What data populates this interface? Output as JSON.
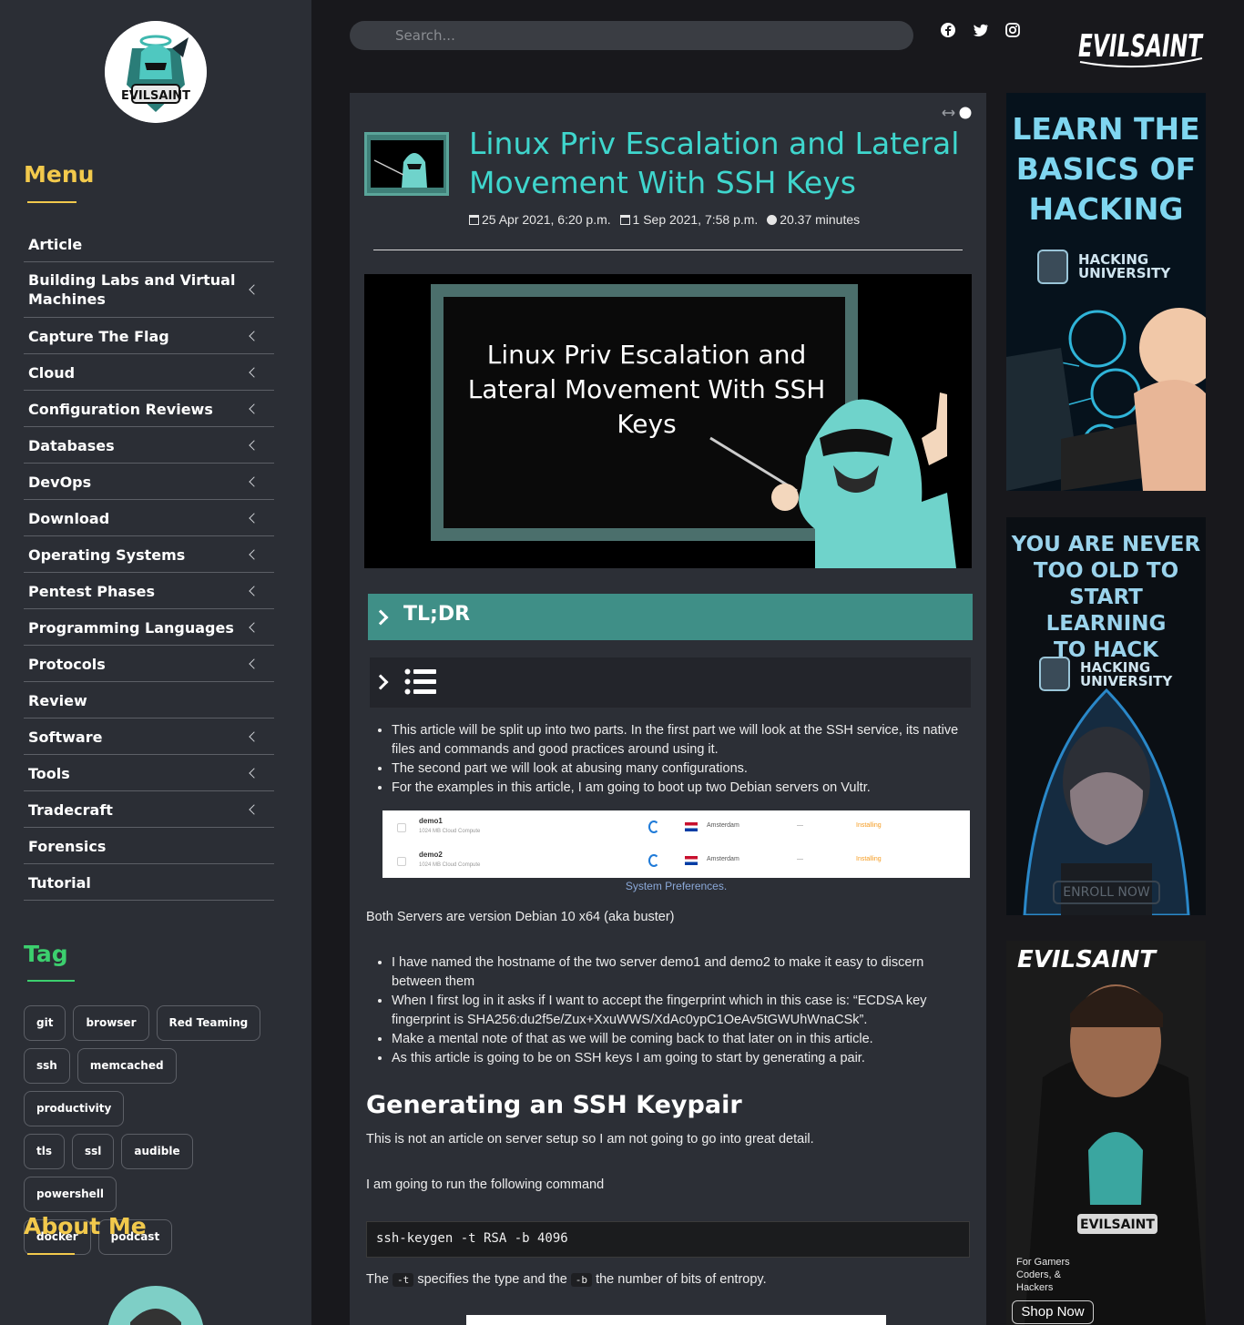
{
  "sidebar": {
    "menu_heading": "Menu",
    "menu": [
      {
        "label": "Article",
        "has_children": false
      },
      {
        "label": "Building Labs and Virtual Machines",
        "has_children": true
      },
      {
        "label": "Capture The Flag",
        "has_children": true
      },
      {
        "label": "Cloud",
        "has_children": true
      },
      {
        "label": "Configuration Reviews",
        "has_children": true
      },
      {
        "label": "Databases",
        "has_children": true
      },
      {
        "label": "DevOps",
        "has_children": true
      },
      {
        "label": "Download",
        "has_children": true
      },
      {
        "label": "Operating Systems",
        "has_children": true
      },
      {
        "label": "Pentest Phases",
        "has_children": true
      },
      {
        "label": "Programming Languages",
        "has_children": true
      },
      {
        "label": "Protocols",
        "has_children": true
      },
      {
        "label": "Review",
        "has_children": false
      },
      {
        "label": "Software",
        "has_children": true
      },
      {
        "label": "Tools",
        "has_children": true
      },
      {
        "label": "Tradecraft",
        "has_children": true
      },
      {
        "label": "Forensics",
        "has_children": false
      },
      {
        "label": "Tutorial",
        "has_children": false
      }
    ],
    "tag_heading": "Tag",
    "tags": [
      "git",
      "browser",
      "Red Teaming",
      "ssh",
      "memcached",
      "productivity",
      "tls",
      "ssl",
      "audible",
      "powershell",
      "docker",
      "podcast"
    ],
    "about_heading": "About Me",
    "logo_text": "EVILSAINT"
  },
  "header": {
    "search_placeholder": "Search...",
    "social": [
      "facebook-icon",
      "twitter-icon",
      "instagram-icon"
    ],
    "brand": "EVILSAINT"
  },
  "article": {
    "title": "Linux Priv Escalation and Lateral Movement With SSH Keys",
    "created": "25 Apr 2021, 6:20 p.m.",
    "updated": "1 Sep 2021, 7:58 p.m.",
    "read_time": "20.37 minutes",
    "hero_text": "Linux Priv Escalation and Lateral Movement With SSH Keys",
    "tldr_label": "TL;DR",
    "intro_bullets": [
      "This article will be split up into two parts. In the first part we will look at the SSH service, its native files and commands and good practices around using it.",
      "The second part we will look at abusing many configurations.",
      "For the examples in this article, I am going to boot up two Debian servers on Vultr."
    ],
    "servers": [
      {
        "name": "demo1",
        "spec": "1024 MB Cloud Compute",
        "location": "Amsterdam",
        "ip": "—",
        "status": "Installing"
      },
      {
        "name": "demo2",
        "spec": "1024 MB Cloud Compute",
        "location": "Amsterdam",
        "ip": "—",
        "status": "Installing"
      }
    ],
    "figure_caption": "System Preferences.",
    "versions_text": "Both Servers are version Debian 10 x64 (aka buster)",
    "host_bullets": [
      "I have named the hostname of the two server demo1 and demo2 to make it easy to discern between them",
      "When I first log in it asks if I want to accept the fingerprint which in this case is: “ECDSA key fingerprint is SHA256:du2f5e/Zux+XxuWWS/XdAc0ypC1OeAv5tGWUhWnaCSk”.",
      "Make a mental note of that as we will be coming back to that later on in this article.",
      "As this article is going to be on SSH keys I am going to start by generating a pair."
    ],
    "h2": "Generating an SSH Keypair",
    "p1": "This is not an article on server setup so I am not going to go into great detail.",
    "p2": "I am going to run the following command",
    "code": "ssh-keygen -t RSA -b 4096",
    "p3_a": "The",
    "p3_code1": "-t",
    "p3_b": "specifies the type and the",
    "p3_code2": "-b",
    "p3_c": "the number of bits of entropy."
  },
  "ads": {
    "ad1": {
      "lines": [
        "LEARN THE",
        "BASICS OF",
        "HACKING"
      ],
      "brand_line1": "HACKING",
      "brand_line2": "UNIVERSITY"
    },
    "ad2": {
      "lines": [
        "YOU ARE NEVER",
        "TOO OLD TO",
        "START LEARNING",
        "TO HACK"
      ],
      "brand_line1": "HACKING",
      "brand_line2": "UNIVERSITY",
      "cta": "ENROLL NOW"
    },
    "ad3": {
      "brand": "EVILSAINT",
      "tagline": "For Gamers Coders, & Hackers",
      "cta": "Shop Now",
      "shirt_text": "EVILSAINT"
    }
  },
  "colors": {
    "sidebar_bg": "#2b2e35",
    "page_bg": "#18181c",
    "article_bg": "#2c2f36",
    "menu_heading": "#f2c94c",
    "tag_heading": "#3ccf6e",
    "title": "#3fd6cd",
    "tldr": "#3f8f87"
  }
}
